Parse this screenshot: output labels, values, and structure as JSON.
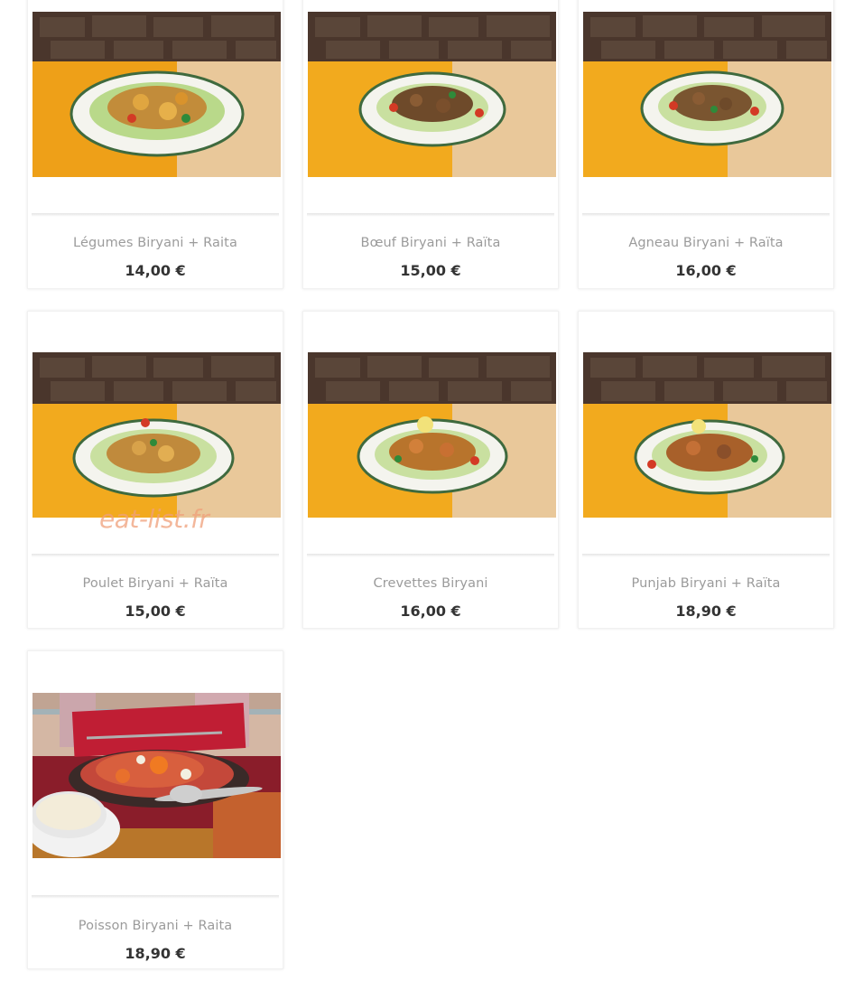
{
  "products": [
    {
      "name": "Légumes Biryani + Raita",
      "price": "14,00 €",
      "photo": "vegetable-biryani-plate"
    },
    {
      "name": "Bœuf Biryani + Raïta",
      "price": "15,00 €",
      "photo": "beef-biryani-plate"
    },
    {
      "name": "Agneau Biryani + Raïta",
      "price": "16,00 €",
      "photo": "lamb-biryani-plate"
    },
    {
      "name": "Poulet Biryani + Raïta",
      "price": "15,00 €",
      "photo": "chicken-biryani-plate"
    },
    {
      "name": "Crevettes Biryani",
      "price": "16,00 €",
      "photo": "prawn-biryani-plate"
    },
    {
      "name": "Punjab Biryani + Raïta",
      "price": "18,90 €",
      "photo": "punjab-biryani-plate"
    },
    {
      "name": "Poisson Biryani + Raita",
      "price": "18,90 €",
      "photo": "fish-biryani-with-raita"
    }
  ],
  "watermark": "eat-list.fr",
  "colors": {
    "product_name": "#9b9b9b",
    "price": "#333333",
    "watermark": "#f0a07a"
  }
}
